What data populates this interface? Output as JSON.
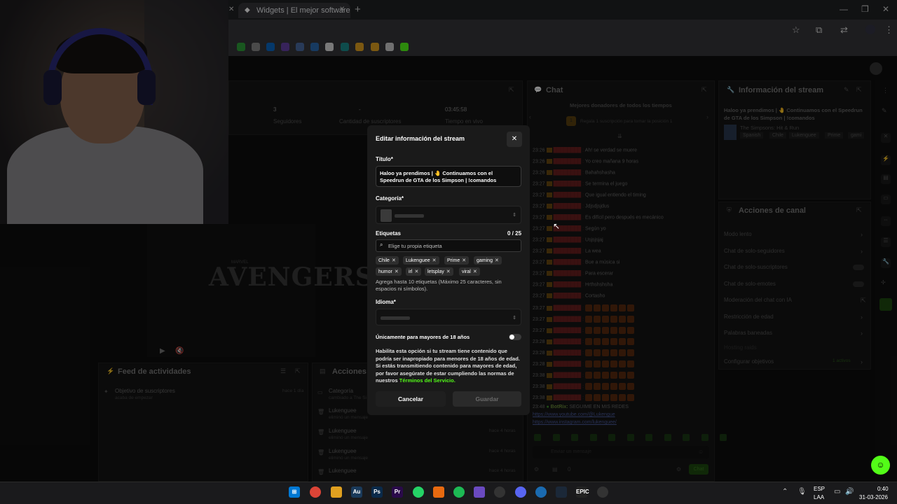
{
  "browser": {
    "tab_title": "Widgets | El mejor software pa",
    "new_tab": "+",
    "close_glyph": "✕"
  },
  "dashboard": {
    "stats": [
      {
        "value": "3",
        "label": "Seguidores"
      },
      {
        "value": "-",
        "label": "Cantidad de suscriptores"
      },
      {
        "value": "03:45:58",
        "label": "Tiempo en vivo"
      }
    ],
    "activity_feed_title": "Feed de actividades",
    "activity_item_title": "Objetivo de suscriptores",
    "activity_item_sub": "acaba de empezar",
    "activity_item_time": "hace 1 día",
    "actions_title": "Acciones de",
    "actions_items": [
      {
        "title": "Categoría",
        "sub": "cambiado a The Si"
      },
      {
        "title": "Lukenguee",
        "sub": "eliminó un mensaje"
      },
      {
        "title": "Lukenguee",
        "sub": "eliminó un mensaje",
        "time": "hace 4 horas"
      },
      {
        "title": "Lukenguee",
        "sub": "eliminó un mensaje",
        "time": "hace 4 horas"
      },
      {
        "title": "Lukenguee",
        "sub": "",
        "time": "hace 4 horas"
      }
    ],
    "chat_title": "Chat",
    "chat_top_donors": "Mejores donadores de todos los tiempos",
    "chat_donor_hint": "Regala 1 suscripción para tomar la posición 1",
    "chat_messages": [
      {
        "time": "23:26",
        "text": "Ah! se verdad se muere"
      },
      {
        "time": "23:26",
        "text": "Yo creo mañana 9 horas"
      },
      {
        "time": "23:26",
        "text": "Bahahshasha"
      },
      {
        "time": "23:27",
        "text": "Se termina el juego"
      },
      {
        "time": "23:27",
        "text": "Que igual entiendo el timing"
      },
      {
        "time": "23:27",
        "text": "Jdjsdjsjdus"
      },
      {
        "time": "23:27",
        "text": "Es difícil pero después es mecánico"
      },
      {
        "time": "23:27",
        "text": "Según yo"
      },
      {
        "time": "23:27",
        "text": "Usjsjsjaj"
      },
      {
        "time": "23:27",
        "text": "La wea"
      },
      {
        "time": "23:27",
        "text": "Bue a música si"
      },
      {
        "time": "23:27",
        "text": "Para escerar"
      },
      {
        "time": "23:27",
        "text": "Hrthshshsha"
      },
      {
        "time": "23:27",
        "text": "Cortasho"
      },
      {
        "time": "23:27",
        "text": ""
      },
      {
        "time": "23:27",
        "text": ""
      },
      {
        "time": "23:27",
        "text": ""
      },
      {
        "time": "23:28",
        "text": ""
      },
      {
        "time": "23:28",
        "text": ""
      },
      {
        "time": "23:28",
        "text": ""
      },
      {
        "time": "23:38",
        "text": ""
      },
      {
        "time": "23:38",
        "text": ""
      },
      {
        "time": "23:38",
        "text": ""
      }
    ],
    "bot_time": "23:48",
    "bot_name": "BotRix:",
    "bot_text": "SEGUIME EN MIS REDES",
    "bot_link1": "https://www.youtube.com/@Lukengue",
    "bot_link2": "https://www.instagram.com/lukenguee/",
    "chat_placeholder": "Enviar un mensaje",
    "chat_send": "Chat",
    "chat_count": "0",
    "info_title": "Información del stream",
    "info_stream_title": "Haloo ya prendimos | 🤚 Continuamos con el Speedrun de GTA de los Simpson | !comandos",
    "info_category": "The Simpsons: Hit & Run",
    "info_tags": [
      "Spanish",
      "Chile",
      "Lukenguee",
      "Prime",
      "gami"
    ],
    "channel_actions_title": "Acciones de canal",
    "channel_actions": [
      "Modo lento",
      "Chat de solo-seguidores",
      "Chat de solo-suscriptores",
      "Chat de solo-emotes",
      "Moderación del chat con IA",
      "Restricción de edad",
      "Palabras baneadas",
      "Hosting raids",
      "Configurar objetivos"
    ],
    "goals_badge": "1 activos"
  },
  "preview": {
    "movie_title": "AVENGERS",
    "movie_brand": "MARVEL"
  },
  "modal": {
    "title": "Editar información del stream",
    "close": "✕",
    "title_label": "Título*",
    "title_value": "Haloo ya prendimos | 🤚 Continuamos con el  Speedrun de GTA de los Simpson | !comandos",
    "category_label": "Categoría*",
    "tags_label": "Etiquetas",
    "tags_count": "0 / 25",
    "tags_placeholder": "Elige tu propia etiqueta",
    "tags": [
      "Chile",
      "Lukenguee",
      "Prime",
      "gaming",
      "humor",
      "irl",
      "letsplay",
      "viral"
    ],
    "tags_help": "Agrega hasta 10 etiquetas (Máximo 25 caracteres, sin espacios ni símbolos).",
    "language_label": "Idioma*",
    "age_label": "Únicamente para mayores de 18 años",
    "age_enabled": false,
    "age_desc": "Habilita esta opción si tu stream tiene contenido que podría ser inapropiado para menores de 18 años de edad. Si estás transmitiendo contenido para mayores de edad, por favor asegúrate de estar cumpliendo las normas de nuestros",
    "terms_link": "Términos del Servicio.",
    "cancel": "Cancelar",
    "save": "Guardar"
  },
  "taskbar": {
    "lang_top": "ESP",
    "lang_bottom": "LAA",
    "time": "0:40",
    "date": "31-03-2026"
  },
  "colors": {
    "accent": "#53fc18",
    "modal_bg": "#1a1a1a",
    "page_bg": "#0e0e0e"
  }
}
